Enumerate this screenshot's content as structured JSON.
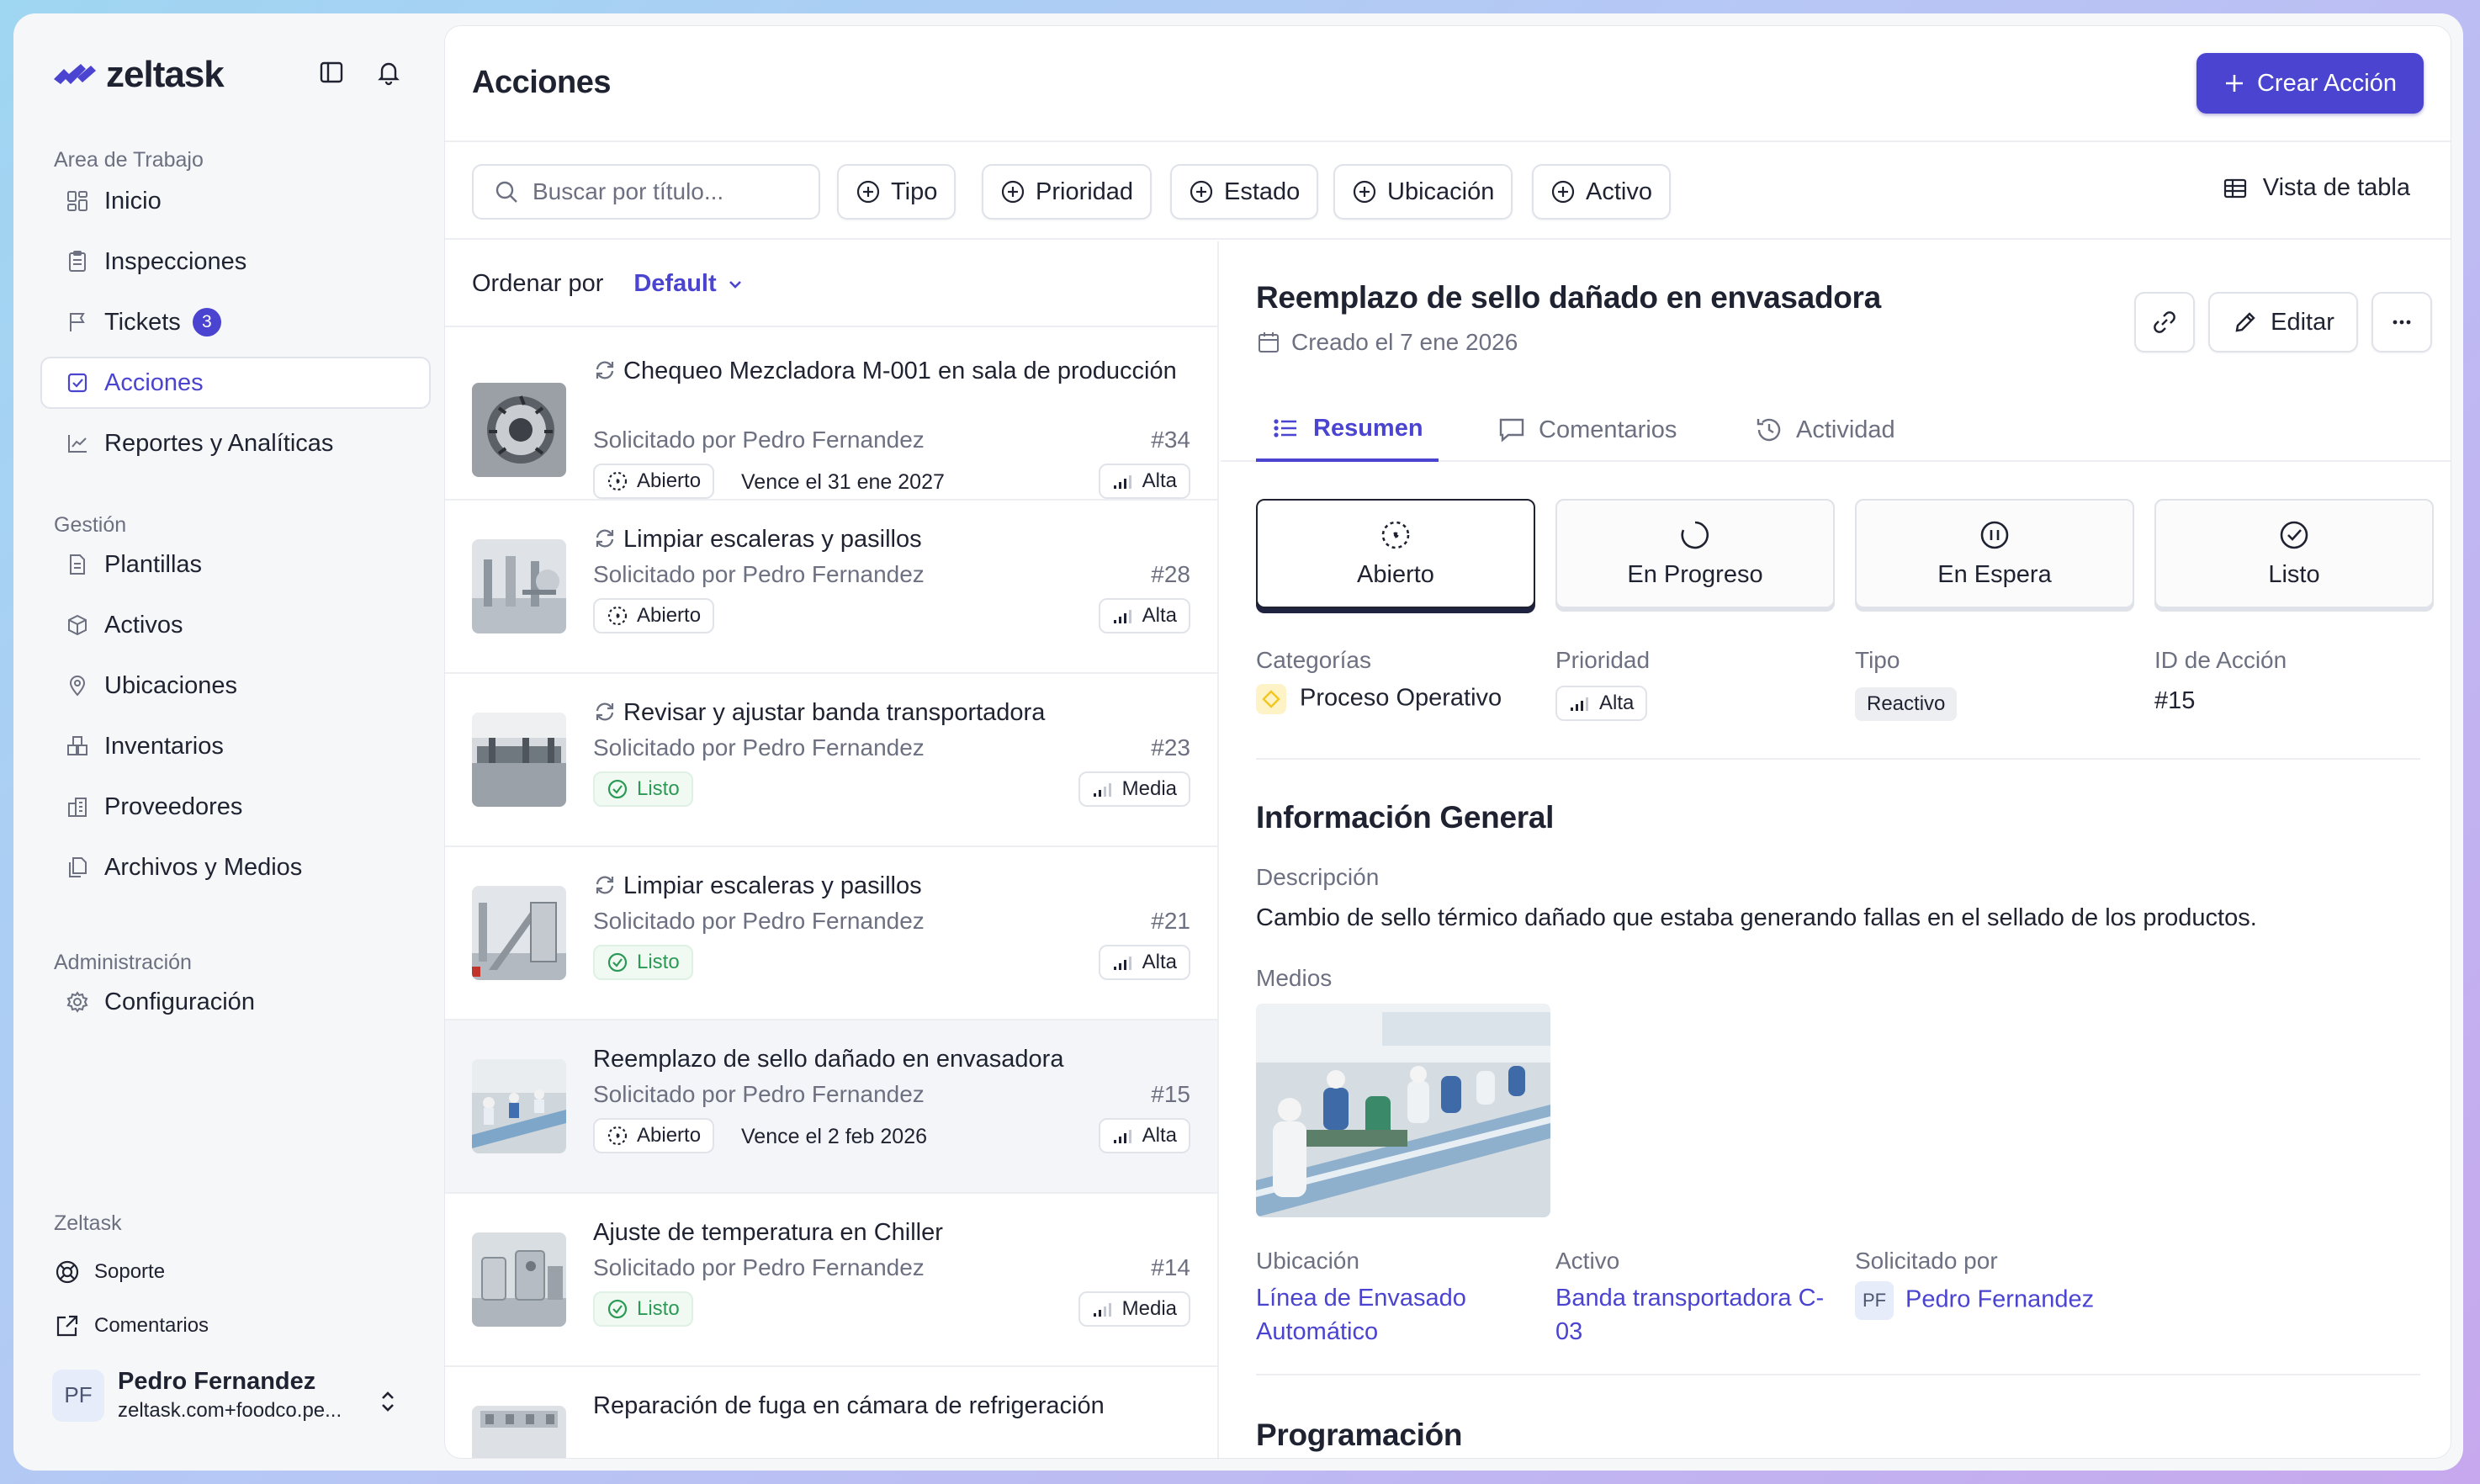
{
  "app": {
    "name": "zeltask"
  },
  "sidebar": {
    "workspace_title": "Area de Trabajo",
    "items": [
      {
        "label": "Inicio"
      },
      {
        "label": "Inspecciones"
      },
      {
        "label": "Tickets",
        "badge": "3"
      },
      {
        "label": "Acciones"
      },
      {
        "label": "Reportes y Analíticas"
      }
    ],
    "management_title": "Gestión",
    "management": [
      {
        "label": "Plantillas"
      },
      {
        "label": "Activos"
      },
      {
        "label": "Ubicaciones"
      },
      {
        "label": "Inventarios"
      },
      {
        "label": "Proveedores"
      },
      {
        "label": "Archivos y Medios"
      }
    ],
    "admin_title": "Administración",
    "admin": [
      {
        "label": "Configuración"
      }
    ],
    "footer_title": "Zeltask",
    "footer": [
      {
        "label": "Soporte"
      },
      {
        "label": "Comentarios"
      }
    ],
    "user": {
      "initials": "PF",
      "name": "Pedro Fernandez",
      "email": "zeltask.com+foodco.pe..."
    }
  },
  "header": {
    "title": "Acciones",
    "create_label": "Crear Acción"
  },
  "filters": {
    "search_placeholder": "Buscar por título...",
    "chips": [
      "Tipo",
      "Prioridad",
      "Estado",
      "Ubicación",
      "Activo"
    ],
    "view_label": "Vista de tabla"
  },
  "list": {
    "sort_label": "Ordenar por",
    "sort_value": "Default",
    "items": [
      {
        "title": "Chequeo Mezcladora M-001 en sala de producción",
        "requester": "Solicitado por Pedro Fernandez",
        "number": "#34",
        "status": "Abierto",
        "due": "Vence el 31 ene 2027",
        "priority": "Alta"
      },
      {
        "title": "Limpiar escaleras y pasillos",
        "requester": "Solicitado por Pedro Fernandez",
        "number": "#28",
        "status": "Abierto",
        "due": "",
        "priority": "Alta"
      },
      {
        "title": "Revisar y ajustar banda transportadora",
        "requester": "Solicitado por Pedro Fernandez",
        "number": "#23",
        "status": "Listo",
        "due": "",
        "priority": "Media"
      },
      {
        "title": "Limpiar escaleras y pasillos",
        "requester": "Solicitado por Pedro Fernandez",
        "number": "#21",
        "status": "Listo",
        "due": "",
        "priority": "Alta"
      },
      {
        "title": "Reemplazo de sello dañado en envasadora",
        "requester": "Solicitado por Pedro Fernandez",
        "number": "#15",
        "status": "Abierto",
        "due": "Vence el 2 feb 2026",
        "priority": "Alta"
      },
      {
        "title": "Ajuste de temperatura en Chiller",
        "requester": "Solicitado por Pedro Fernandez",
        "number": "#14",
        "status": "Listo",
        "due": "",
        "priority": "Media"
      },
      {
        "title": "Reparación de fuga en cámara de refrigeración",
        "requester": "",
        "number": "",
        "status": "",
        "due": "",
        "priority": ""
      }
    ]
  },
  "detail": {
    "title": "Reemplazo de sello dañado en envasadora",
    "created": "Creado el 7 ene 2026",
    "edit_label": "Editar",
    "tabs": [
      "Resumen",
      "Comentarios",
      "Actividad"
    ],
    "statuses": [
      "Abierto",
      "En Progreso",
      "En Espera",
      "Listo"
    ],
    "active_status": "Abierto",
    "fields": {
      "categories_label": "Categorías",
      "categories_value": "Proceso Operativo",
      "priority_label": "Prioridad",
      "priority_value": "Alta",
      "type_label": "Tipo",
      "type_value": "Reactivo",
      "id_label": "ID de Acción",
      "id_value": "#15"
    },
    "general_title": "Información General",
    "description_label": "Descripción",
    "description": "Cambio de sello térmico dañado que estaba generando fallas en el sellado de los productos.",
    "media_label": "Medios",
    "location_label": "Ubicación",
    "location_line1": "Línea de Envasado",
    "location_line2": "Automático",
    "asset_label": "Activo",
    "asset_line1": "Banda transportadora C-",
    "asset_line2": "03",
    "requested_label": "Solicitado por",
    "requested_initials": "PF",
    "requested_name": "Pedro Fernandez",
    "schedule_title": "Programación"
  },
  "colors": {
    "accent": "#4a44d0",
    "done": "#2c9a55",
    "category": "#f3c61f"
  }
}
